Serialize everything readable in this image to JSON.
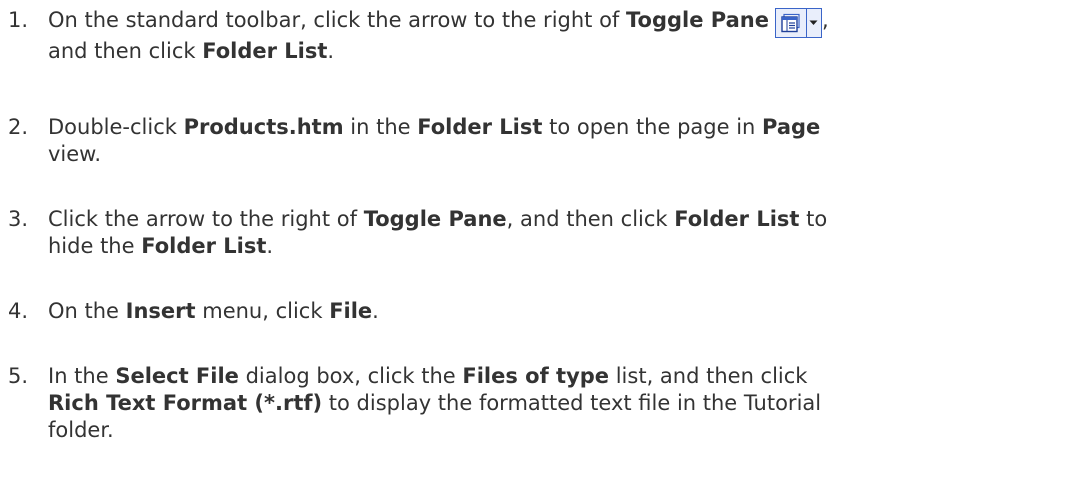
{
  "steps": [
    {
      "number": "1.",
      "parts": [
        "On the standard toolbar, click the arrow to the right of ",
        "Toggle Pane",
        ",",
        "and then click ",
        "Folder List",
        "."
      ]
    },
    {
      "number": "2.",
      "parts": [
        "Double-click ",
        "Products.htm",
        " in the ",
        "Folder List",
        " to open the page in ",
        "Page",
        "view."
      ]
    },
    {
      "number": "3.",
      "parts": [
        "Click the arrow to the right of ",
        "Toggle Pane",
        ", and then click ",
        "Folder List",
        " to",
        "hide the ",
        "Folder List",
        "."
      ]
    },
    {
      "number": "4.",
      "parts": [
        "On the ",
        "Insert",
        " menu, click ",
        "File",
        "."
      ]
    },
    {
      "number": "5.",
      "parts": [
        "In the ",
        "Select File",
        " dialog box, click the ",
        "Files of type",
        " list, and then click",
        "Rich Text Format (*.rtf)",
        " to display the formatted text file in the Tutorial",
        "folder."
      ]
    }
  ],
  "icons": {
    "toggle_pane": "toggle-pane-icon",
    "dropdown": "dropdown-arrow-icon"
  },
  "colors": {
    "text": "#333333",
    "icon_border": "#3a64c8",
    "icon_fill": "#e9eefb"
  }
}
